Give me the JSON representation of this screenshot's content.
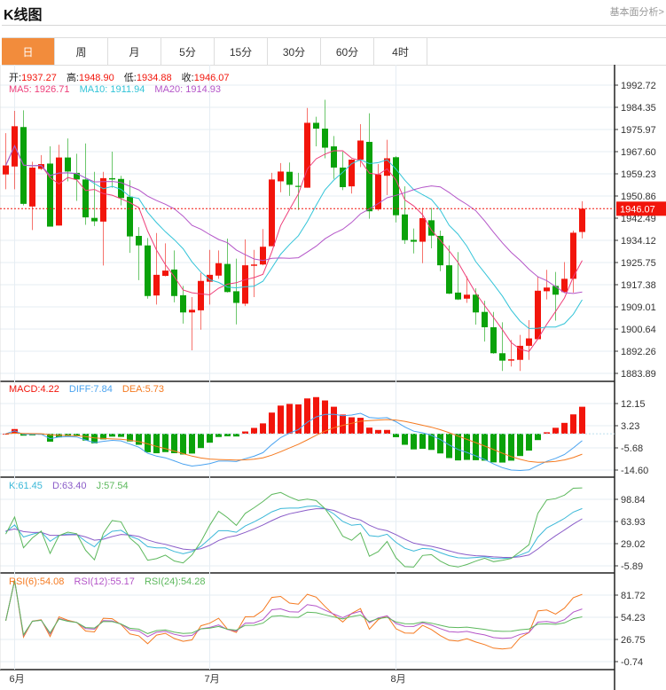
{
  "header": {
    "title": "K线图",
    "link": "基本面分析>"
  },
  "tabs": [
    {
      "label": "日",
      "active": true
    },
    {
      "label": "周"
    },
    {
      "label": "月"
    },
    {
      "label": "5分"
    },
    {
      "label": "15分"
    },
    {
      "label": "30分"
    },
    {
      "label": "60分"
    },
    {
      "label": "4时"
    }
  ],
  "ohlc_legend": {
    "open_label": "开:",
    "open": "1937.27",
    "high_label": "高:",
    "high": "1948.90",
    "low_label": "低:",
    "low": "1934.88",
    "close_label": "收:",
    "close": "1946.07"
  },
  "ma_legend": {
    "ma5": "MA5: 1926.71",
    "ma10": "MA10: 1911.94",
    "ma20": "MA20: 1914.93"
  },
  "macd_legend": {
    "macd": "MACD:4.22",
    "diff": "DIFF:7.84",
    "dea": "DEA:5.73"
  },
  "kdj_legend": {
    "k": "K:61.45",
    "d": "D:63.40",
    "j": "J:57.54"
  },
  "rsi_legend": {
    "rsi6": "RSI(6):54.08",
    "rsi12": "RSI(12):55.17",
    "rsi24": "RSI(24):54.28"
  },
  "current_price": "1946.07",
  "colors": {
    "up": "#f2150b",
    "down": "#0aa20a",
    "ma5": "#ee3f7a",
    "ma10": "#33c4d8",
    "ma20": "#b455c8",
    "diff": "#4aa3f0",
    "dea": "#f57a20",
    "k": "#3bb8d8",
    "d": "#8a5cc8",
    "j": "#5cb85c",
    "rsi6": "#f57a20",
    "rsi12": "#b455c8",
    "rsi24": "#5cb85c",
    "accent": "#f28c3c"
  },
  "chart_data": [
    {
      "type": "candlestick",
      "title": "",
      "y_ticks": [
        "1992.72",
        "1984.35",
        "1975.97",
        "1967.60",
        "1959.23",
        "1950.86",
        "1942.49",
        "1934.12",
        "1925.75",
        "1917.38",
        "1909.01",
        "1900.64",
        "1892.26",
        "1883.89"
      ],
      "ylim": [
        1883.89,
        1992.72
      ],
      "x_ticks": [
        {
          "label": "6月",
          "index": 1
        },
        {
          "label": "7月",
          "index": 23
        },
        {
          "label": "8月",
          "index": 44
        }
      ],
      "grid": true,
      "ohlc": [
        [
          1959.0,
          1974.6,
          1953.4,
          1962.4
        ],
        [
          1962.0,
          1983.0,
          1953.4,
          1977.2
        ],
        [
          1976.9,
          1983.2,
          1947.3,
          1947.9
        ],
        [
          1946.9,
          1963.8,
          1938.0,
          1961.6
        ],
        [
          1961.1,
          1966.3,
          1960.7,
          1962.9
        ],
        [
          1963.1,
          1969.6,
          1939.3,
          1939.3
        ],
        [
          1939.7,
          1970.2,
          1939.7,
          1965.4
        ],
        [
          1965.4,
          1972.6,
          1956.4,
          1960.1
        ],
        [
          1959.6,
          1966.8,
          1949.0,
          1957.1
        ],
        [
          1957.1,
          1970.7,
          1940.0,
          1942.8
        ],
        [
          1942.6,
          1960.0,
          1939.5,
          1941.3
        ],
        [
          1941.2,
          1960.0,
          1924.6,
          1957.6
        ],
        [
          1957.6,
          1967.6,
          1954.0,
          1957.1
        ],
        [
          1957.3,
          1958.5,
          1947.3,
          1950.1
        ],
        [
          1950.6,
          1956.8,
          1929.4,
          1935.6
        ],
        [
          1935.8,
          1939.1,
          1919.1,
          1932.2
        ],
        [
          1932.2,
          1935.0,
          1912.1,
          1913.1
        ],
        [
          1913.3,
          1936.9,
          1909.9,
          1921.1
        ],
        [
          1920.7,
          1933.0,
          1920.5,
          1922.7
        ],
        [
          1923.1,
          1930.3,
          1910.7,
          1913.1
        ],
        [
          1913.4,
          1916.9,
          1902.7,
          1906.9
        ],
        [
          1906.9,
          1912.7,
          1892.6,
          1907.9
        ],
        [
          1907.7,
          1921.8,
          1900.4,
          1918.8
        ],
        [
          1918.5,
          1930.5,
          1909.9,
          1921.1
        ],
        [
          1920.8,
          1930.3,
          1919.6,
          1925.5
        ],
        [
          1925.2,
          1934.8,
          1914.4,
          1914.6
        ],
        [
          1914.9,
          1927.2,
          1902.4,
          1910.5
        ],
        [
          1910.2,
          1934.5,
          1909.3,
          1924.7
        ],
        [
          1924.5,
          1930.5,
          1912.7,
          1925.0
        ],
        [
          1925.0,
          1938.4,
          1924.7,
          1931.7
        ],
        [
          1931.9,
          1959.6,
          1931.9,
          1957.1
        ],
        [
          1956.4,
          1963.3,
          1952.3,
          1960.1
        ],
        [
          1960.0,
          1963.5,
          1950.9,
          1955.1
        ],
        [
          1954.7,
          1959.6,
          1945.6,
          1954.4
        ],
        [
          1954.0,
          1984.1,
          1954.0,
          1978.5
        ],
        [
          1978.5,
          1980.8,
          1969.6,
          1976.3
        ],
        [
          1976.3,
          1987.2,
          1965.1,
          1969.1
        ],
        [
          1969.6,
          1973.5,
          1957.3,
          1961.6
        ],
        [
          1961.6,
          1967.6,
          1953.1,
          1954.2
        ],
        [
          1954.5,
          1964.8,
          1951.8,
          1964.6
        ],
        [
          1964.6,
          1978.0,
          1961.8,
          1971.8
        ],
        [
          1971.3,
          1982.1,
          1942.3,
          1945.1
        ],
        [
          1945.8,
          1962.9,
          1945.3,
          1959.0
        ],
        [
          1958.5,
          1972.1,
          1951.2,
          1965.1
        ],
        [
          1965.5,
          1965.9,
          1940.9,
          1943.6
        ],
        [
          1943.9,
          1954.5,
          1932.8,
          1934.2
        ],
        [
          1934.3,
          1938.6,
          1929.2,
          1933.6
        ],
        [
          1933.6,
          1946.4,
          1925.5,
          1942.5
        ],
        [
          1941.7,
          1946.4,
          1931.1,
          1935.9
        ],
        [
          1935.8,
          1937.8,
          1922.5,
          1924.7
        ],
        [
          1924.7,
          1932.2,
          1913.8,
          1914.0
        ],
        [
          1914.4,
          1929.7,
          1911.6,
          1911.8
        ],
        [
          1912.1,
          1920.5,
          1910.5,
          1913.6
        ],
        [
          1913.6,
          1916.0,
          1902.3,
          1906.9
        ],
        [
          1907.1,
          1911.3,
          1895.9,
          1901.3
        ],
        [
          1901.3,
          1907.1,
          1891.3,
          1891.5
        ],
        [
          1891.5,
          1903.2,
          1884.8,
          1888.7
        ],
        [
          1888.7,
          1896.5,
          1886.5,
          1889.2
        ],
        [
          1889.0,
          1898.4,
          1884.8,
          1894.3
        ],
        [
          1894.3,
          1904.0,
          1889.0,
          1897.1
        ],
        [
          1896.8,
          1920.5,
          1896.8,
          1915.1
        ],
        [
          1914.9,
          1923.0,
          1911.8,
          1916.3
        ],
        [
          1916.9,
          1922.2,
          1903.8,
          1913.6
        ],
        [
          1914.6,
          1925.9,
          1914.4,
          1919.6
        ],
        [
          1919.6,
          1937.8,
          1914.4,
          1937.0
        ],
        [
          1937.27,
          1948.9,
          1934.88,
          1946.07
        ]
      ],
      "overlays": [
        "MA5",
        "MA10",
        "MA20"
      ]
    },
    {
      "type": "bar+line",
      "name": "MACD",
      "y_ticks": [
        "12.15",
        "3.23",
        "-5.68",
        "-14.60"
      ],
      "ylim": [
        -14.6,
        12.15
      ],
      "series": [
        "MACD",
        "DIFF",
        "DEA"
      ]
    },
    {
      "type": "line",
      "name": "KDJ",
      "y_ticks": [
        "98.84",
        "63.93",
        "29.02",
        "-5.89"
      ],
      "ylim": [
        -5.89,
        98.84
      ],
      "series": [
        "K",
        "D",
        "J"
      ]
    },
    {
      "type": "line",
      "name": "RSI",
      "y_ticks": [
        "81.72",
        "54.23",
        "26.75",
        "-0.74"
      ],
      "ylim": [
        -0.74,
        81.72
      ],
      "series": [
        "RSI(6)",
        "RSI(12)",
        "RSI(24)"
      ]
    }
  ]
}
